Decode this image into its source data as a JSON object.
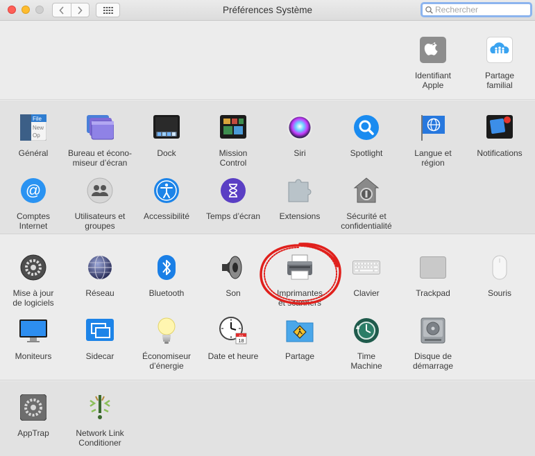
{
  "window": {
    "title": "Préférences Système"
  },
  "search": {
    "placeholder": "Rechercher"
  },
  "section1": [
    {
      "label": "Identifiant\nApple",
      "icon": "apple-id-icon"
    },
    {
      "label": "Partage\nfamilial",
      "icon": "family-sharing-icon"
    }
  ],
  "section2": [
    {
      "label": "Général",
      "icon": "general-icon",
      "icon_text": [
        "File",
        "New",
        "Op"
      ]
    },
    {
      "label": "Bureau et écono-\nmiseur d’écran",
      "icon": "desktop-screensaver-icon"
    },
    {
      "label": "Dock",
      "icon": "dock-icon"
    },
    {
      "label": "Mission\nControl",
      "icon": "mission-control-icon"
    },
    {
      "label": "Siri",
      "icon": "siri-icon"
    },
    {
      "label": "Spotlight",
      "icon": "spotlight-icon"
    },
    {
      "label": "Langue et\nrégion",
      "icon": "language-region-icon"
    },
    {
      "label": "Notifications",
      "icon": "notifications-icon"
    },
    {
      "label": "Comptes\nInternet",
      "icon": "internet-accounts-icon"
    },
    {
      "label": "Utilisateurs et\ngroupes",
      "icon": "users-groups-icon"
    },
    {
      "label": "Accessibilité",
      "icon": "accessibility-icon"
    },
    {
      "label": "Temps d’écran",
      "icon": "screen-time-icon"
    },
    {
      "label": "Extensions",
      "icon": "extensions-icon"
    },
    {
      "label": "Sécurité et\nconfidentialité",
      "icon": "security-privacy-icon"
    }
  ],
  "section3": [
    {
      "label": "Mise à jour\nde logiciels",
      "icon": "software-update-icon"
    },
    {
      "label": "Réseau",
      "icon": "network-icon"
    },
    {
      "label": "Bluetooth",
      "icon": "bluetooth-icon"
    },
    {
      "label": "Son",
      "icon": "sound-icon"
    },
    {
      "label": "Imprimantes\net scanners",
      "icon": "printer-icon"
    },
    {
      "label": "Clavier",
      "icon": "keyboard-icon"
    },
    {
      "label": "Trackpad",
      "icon": "trackpad-icon"
    },
    {
      "label": "Souris",
      "icon": "mouse-icon"
    },
    {
      "label": "Moniteurs",
      "icon": "displays-icon"
    },
    {
      "label": "Sidecar",
      "icon": "sidecar-icon"
    },
    {
      "label": "Économiseur\nd’énergie",
      "icon": "energy-saver-icon"
    },
    {
      "label": "Date et heure",
      "icon": "date-time-icon",
      "icon_text": [
        "JUL",
        "18"
      ]
    },
    {
      "label": "Partage",
      "icon": "sharing-icon"
    },
    {
      "label": "Time\nMachine",
      "icon": "time-machine-icon"
    },
    {
      "label": "Disque de\ndémarrage",
      "icon": "startup-disk-icon"
    }
  ],
  "section4": [
    {
      "label": "AppTrap",
      "icon": "apptrap-icon"
    },
    {
      "label": "Network Link\nConditioner",
      "icon": "network-link-conditioner-icon"
    }
  ],
  "colors": {
    "highlight": "#e0201c",
    "accent": "#1f7fe6"
  }
}
